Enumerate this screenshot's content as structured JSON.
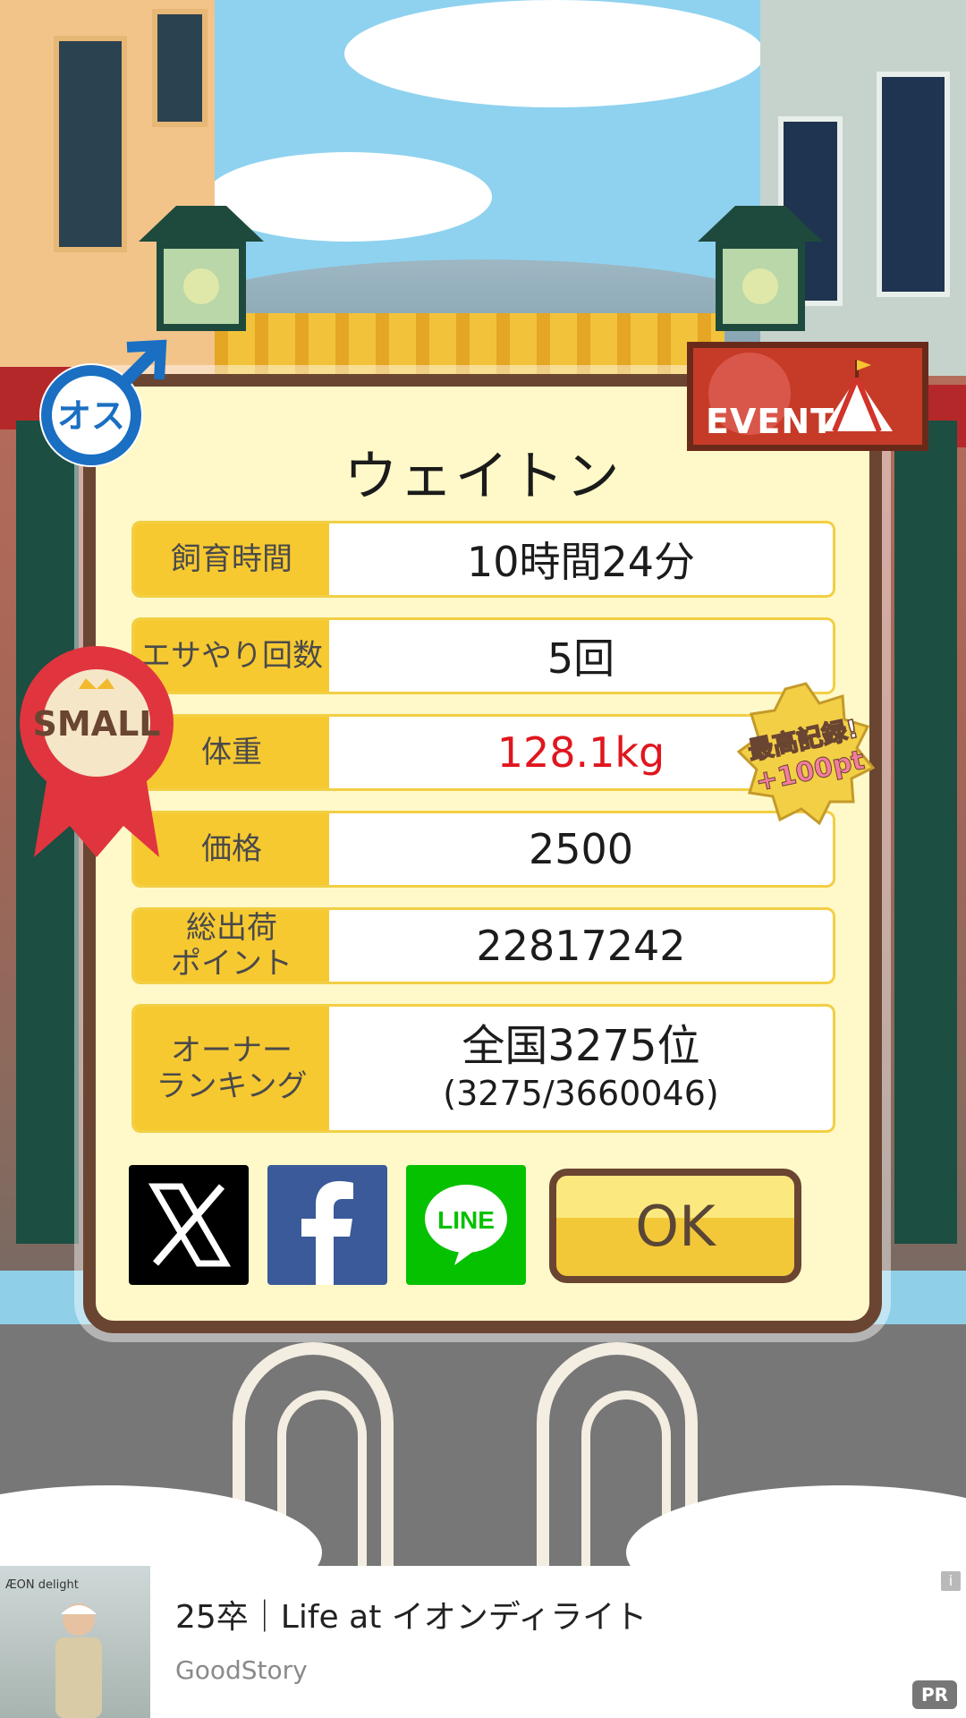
{
  "pet": {
    "name": "ウェイトン",
    "gender_label": "オス",
    "size_label": "SMALL"
  },
  "event_badge": {
    "label": "EVENT"
  },
  "record_badge": {
    "line1": "最高記録!",
    "line2": "+100pt"
  },
  "stats": [
    {
      "label": "飼育時間",
      "value": "10時間24分"
    },
    {
      "label": "エサやり回数",
      "value": "5回"
    },
    {
      "label": "体重",
      "value": "128.1kg"
    },
    {
      "label": "価格",
      "value": "2500"
    },
    {
      "label": "総出荷\nポイント",
      "value": "22817242"
    }
  ],
  "ranking": {
    "label": "オーナー\nランキング",
    "value_line1": "全国3275位",
    "value_line2": "(3275/3660046)"
  },
  "share": {
    "x_label": "X",
    "facebook_label": "f",
    "line_label": "LINE"
  },
  "ok_button": {
    "label": "OK"
  },
  "ad": {
    "brand": "ÆON delight",
    "title": "25卒｜Life at イオンディライト",
    "source": "GoodStory",
    "info_label": "i",
    "pr_label": "PR"
  },
  "colors": {
    "dialog_bg": "#fff9c9",
    "label_bg": "#f7c931",
    "frame": "#6a4532",
    "weight_red": "#e0161e",
    "line_green": "#06c100",
    "facebook_blue": "#3a5a99"
  }
}
